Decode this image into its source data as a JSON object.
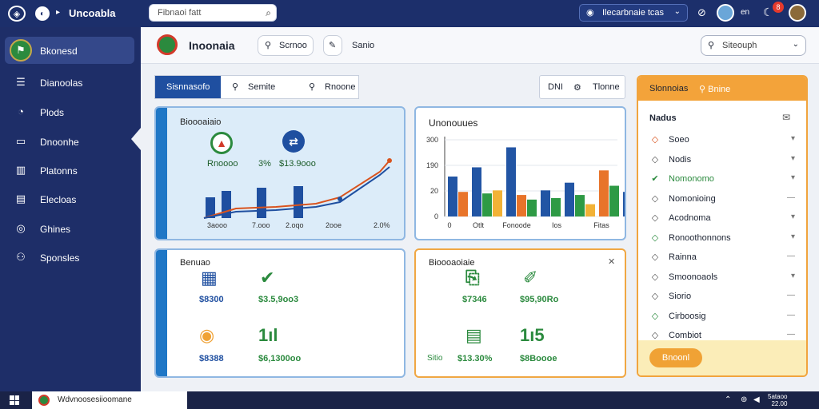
{
  "topbar": {
    "title": "Uncoabla",
    "search_value": "Fibnaoi fatt",
    "user_label": "Ilecarbnaie tcas",
    "badge": "8",
    "icons": [
      "logo-icon",
      "app-icon",
      "chevron-down-icon",
      "search-icon",
      "user-icon",
      "chevron-down-icon",
      "help-icon",
      "globe-icon",
      "notification-icon",
      "avatar"
    ]
  },
  "sidebar": {
    "items": [
      {
        "label": "Bkonesd",
        "icon": "shield-logo-icon",
        "active": true
      },
      {
        "label": "Dianoolas",
        "icon": "list-icon"
      },
      {
        "label": "Plods",
        "icon": "pie-icon"
      },
      {
        "label": "Dnoonhe",
        "icon": "monitor-icon"
      },
      {
        "label": "Platonns",
        "icon": "building-icon"
      },
      {
        "label": "Elecloas",
        "icon": "document-icon"
      },
      {
        "label": "Ghines",
        "icon": "globe-icon"
      },
      {
        "label": "Sponsles",
        "icon": "users-icon"
      }
    ]
  },
  "header": {
    "title": "Inoonaia",
    "btn1_label": "Scrnoo",
    "btn2_label": "Sanio",
    "select_value": "Siteouph"
  },
  "tabs": [
    {
      "label": "Sisnnasofo",
      "active": true
    },
    {
      "label": "Semite",
      "icon": "search-icon"
    },
    {
      "label": "Rnoone",
      "icon": "search-icon"
    }
  ],
  "controls": {
    "item1": "DNI",
    "item2": "Tlonne"
  },
  "overview_card": {
    "title": "Bioooaiaio",
    "stat1": "Rnoooo",
    "stat2": "3%",
    "stat3": "$13.9ooo",
    "x_labels": [
      "3aooo",
      "7.ooo",
      "2.oqo",
      "2ooe",
      "2.0%"
    ]
  },
  "chart_card": {
    "title": "Unonouues",
    "chart_data": {
      "type": "bar",
      "yticks": [
        "300",
        "190",
        "20",
        "0"
      ],
      "x_labels": [
        "0",
        "Otlt",
        "Fonoode",
        "Ios",
        "Fitas"
      ],
      "series_colors": [
        "#2255a4",
        "#e8742a",
        "#2e9a45",
        "#f2b236"
      ],
      "groups": [
        [
          130,
          80,
          0,
          0
        ],
        [
          160,
          0,
          75,
          85
        ],
        [
          225,
          70,
          55,
          0
        ],
        [
          85,
          0,
          60,
          0
        ],
        [
          110,
          0,
          70,
          40
        ],
        [
          0,
          150,
          100,
          0
        ],
        [
          80,
          100,
          0,
          130
        ]
      ],
      "ylim": [
        0,
        260
      ]
    }
  },
  "kpi_card_left": {
    "title": "Benuao",
    "items": [
      {
        "icon": "calendar-icon",
        "value": "$8300",
        "color": "#1f4fa0"
      },
      {
        "icon": "chart-logo-icon",
        "value": "$3.5,9oo3",
        "color": "#2b8a3e"
      },
      {
        "icon": "badge-icon",
        "value": "$8388",
        "color": "#f0a235"
      },
      {
        "icon": "number-icon",
        "value": "$6,1300oo",
        "color": "#2b8a3e"
      }
    ]
  },
  "kpi_card_right": {
    "title": "Bioooaoiaie",
    "items": [
      {
        "icon": "id-card-icon",
        "value": "$7346",
        "color": "#2b8a3e"
      },
      {
        "icon": "tools-icon",
        "value": "$95,90Ro",
        "color": "#2b8a3e"
      },
      {
        "icon": "report-icon",
        "value": "$13.30%",
        "color": "#2b8a3e"
      },
      {
        "icon": "number-icon",
        "value": "$8Boooe",
        "color": "#2b8a3e"
      }
    ],
    "side_label": "Sitio"
  },
  "right_panel": {
    "header_title": "Slonnoias",
    "header_button": "Bnine",
    "subtitle": "Nadus",
    "rows": [
      {
        "label": "Soeo",
        "icon_color": "#d9531e",
        "ctl": "▾"
      },
      {
        "label": "Nodis",
        "icon_color": "#555",
        "ctl": "▾"
      },
      {
        "label": "Nomonomo",
        "icon_color": "#2b8a3e",
        "ctl": "▾",
        "highlight": true
      },
      {
        "label": "Nomonioing",
        "icon_color": "#555",
        "ctl": "—"
      },
      {
        "label": "Acodnoma",
        "icon_color": "#555",
        "ctl": "▾"
      },
      {
        "label": "Ronoothonnons",
        "icon_color": "#2b8a3e",
        "ctl": "▾"
      },
      {
        "label": "Rainna",
        "icon_color": "#555",
        "ctl": "—"
      },
      {
        "label": "Smoonoaols",
        "icon_color": "#555",
        "ctl": "▾"
      },
      {
        "label": "Siorio",
        "icon_color": "#555",
        "ctl": "—"
      },
      {
        "label": "Cirboosig",
        "icon_color": "#2b8a3e",
        "ctl": "—"
      },
      {
        "label": "Combiot",
        "icon_color": "#555",
        "ctl": "—"
      }
    ],
    "footer_button": "Bnoonl"
  },
  "taskbar": {
    "app_label": "Wdvnoosesiioomane",
    "clock_line1": "5ataoo",
    "clock_line2": "22.00"
  }
}
